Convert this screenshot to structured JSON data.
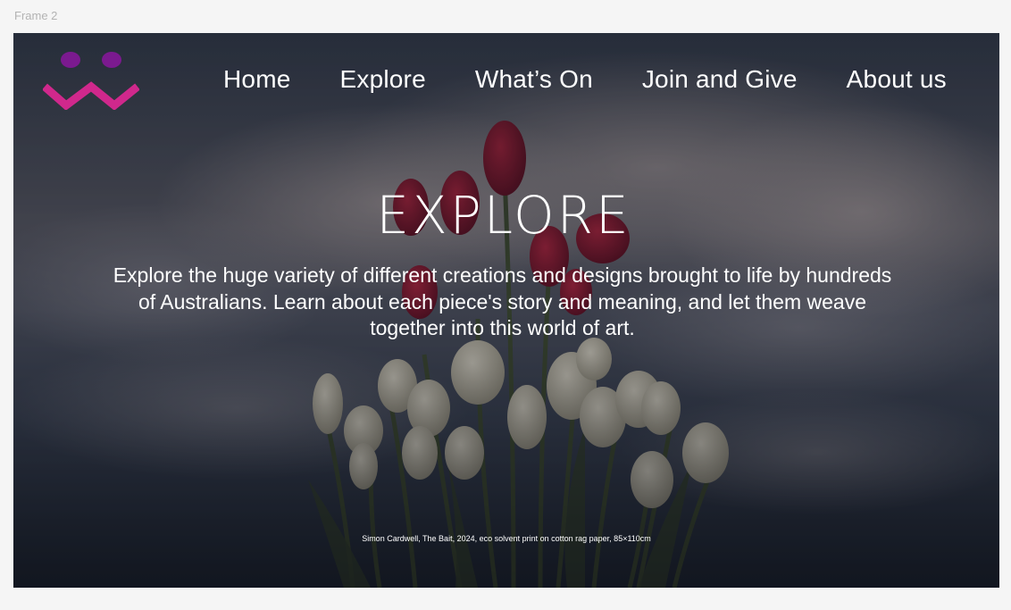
{
  "canvas": {
    "frame_label": "Frame 2"
  },
  "nav": {
    "items": [
      {
        "label": "Home"
      },
      {
        "label": "Explore"
      },
      {
        "label": "What’s On"
      },
      {
        "label": "Join and Give"
      },
      {
        "label": "About us"
      }
    ]
  },
  "hero": {
    "title": "EXPLORE",
    "description": "Explore the huge variety of different creations and designs brought to life by hundreds of Australians. Learn about each piece's story and meaning, and let them weave together into this world of art.",
    "caption": "Simon Cardwell, The Bait, 2024, eco solvent print on cotton rag paper, 85×110cm"
  },
  "brand": {
    "logo_icon": "smiley-zigzag-logo",
    "logo_eye_color": "#7b1a8f",
    "logo_mouth_color": "#d0288c"
  }
}
